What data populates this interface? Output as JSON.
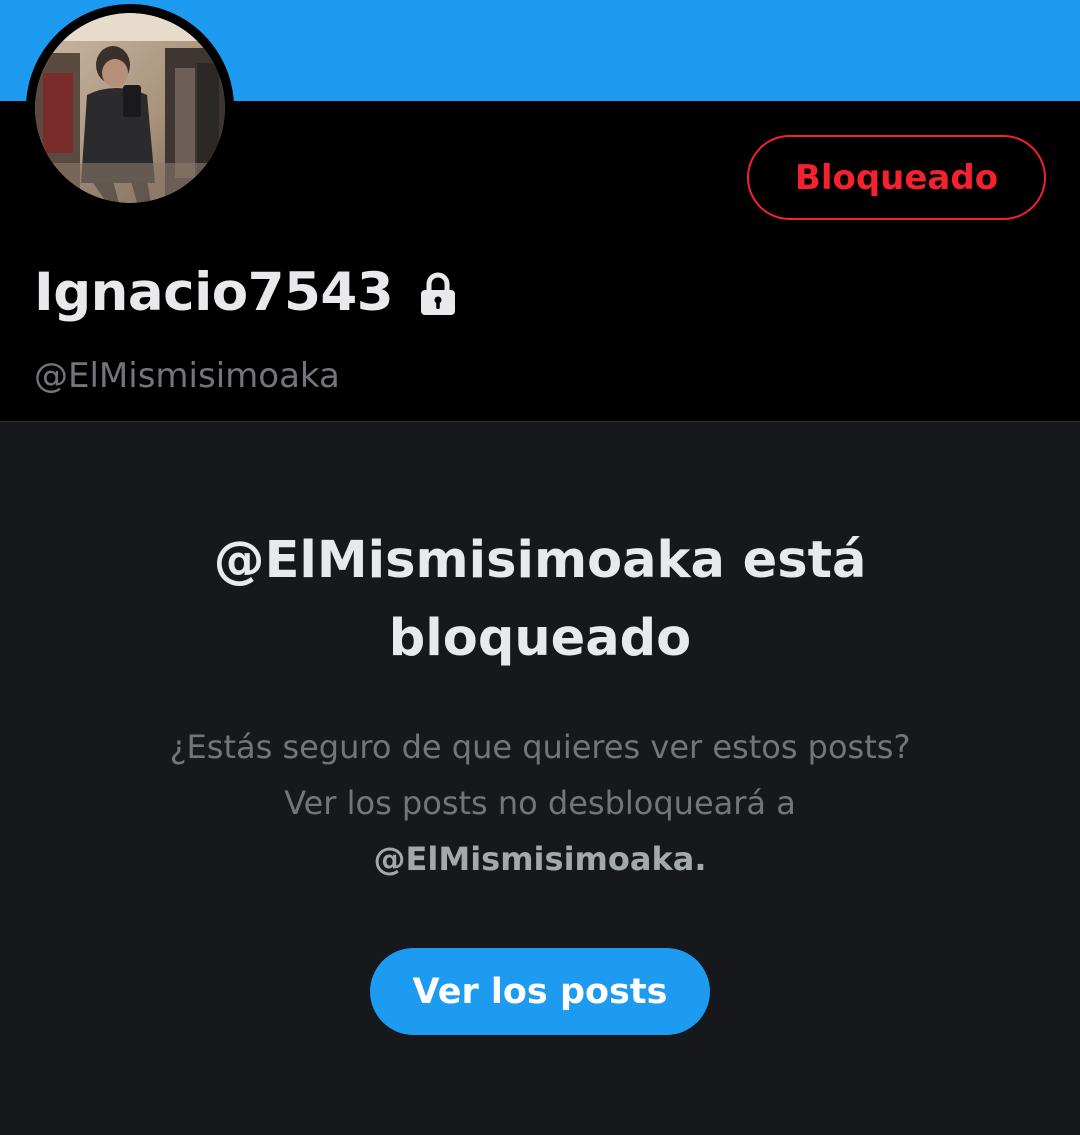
{
  "profile": {
    "display_name": "Ignacio7543",
    "handle": "@ElMismisimoaka",
    "blocked_label": "Bloqueado",
    "avatar_icon": "profile-photo",
    "lock_icon": "lock-icon"
  },
  "blocked_notice": {
    "title": "@ElMismisimoaka está bloqueado",
    "message": "¿Estás seguro de que quieres ver estos posts? Ver los posts no desbloqueará a",
    "message_handle": "@ElMismisimoaka.",
    "view_button_label": "Ver los posts"
  },
  "colors": {
    "banner": "#1d9bf0",
    "accent": "#1d9bf0",
    "blocked_red": "#f4212e",
    "background": "#000000",
    "panel": "#16181c",
    "primary_text": "#e7e9ea",
    "secondary_text": "#71767b"
  }
}
